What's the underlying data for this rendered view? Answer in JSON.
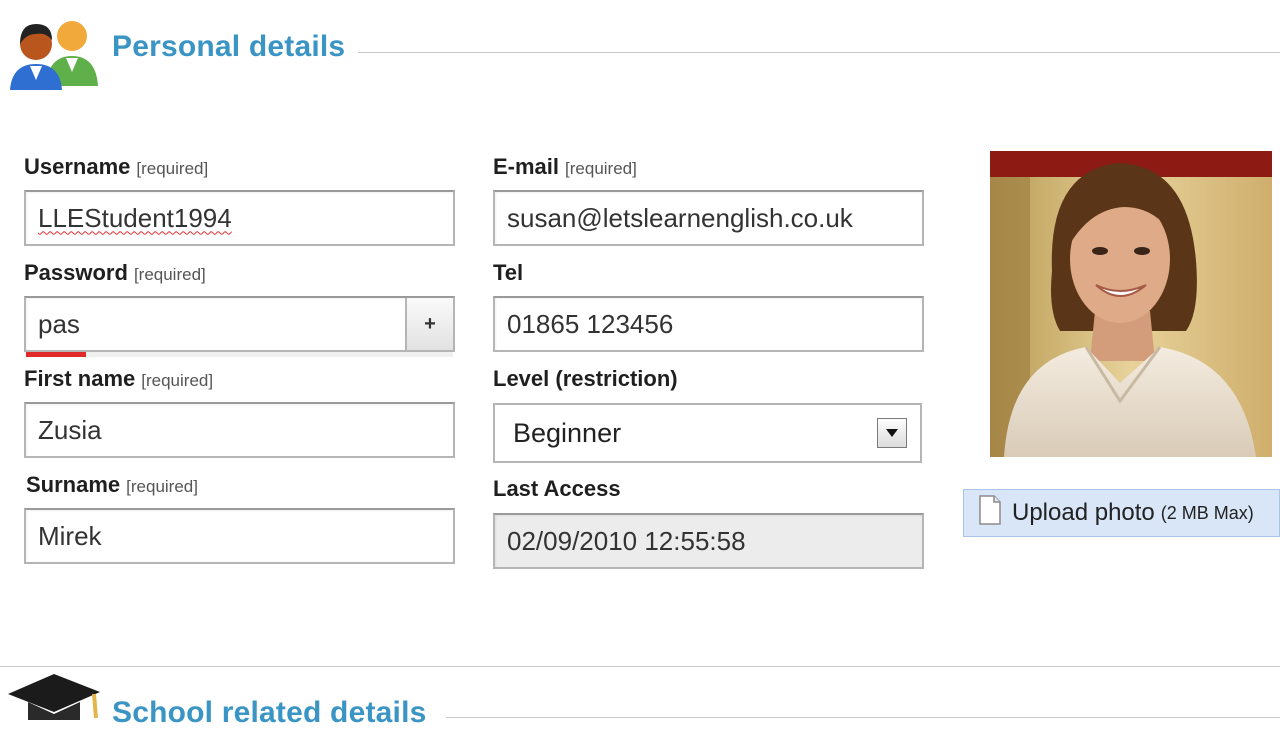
{
  "sections": {
    "personal": {
      "title": "Personal details",
      "icon": "users-icon"
    },
    "school": {
      "title": "School related details",
      "icon": "graduation-cap-icon"
    }
  },
  "required_tag": "[required]",
  "form": {
    "username": {
      "label": "Username",
      "value": "LLEStudent1994"
    },
    "email": {
      "label": "E-mail",
      "value": "susan@letslearnenglish.co.uk"
    },
    "password": {
      "label": "Password",
      "value": "pas",
      "toggle_label": "+",
      "strength_fraction": 0.14
    },
    "tel": {
      "label": "Tel",
      "value": "01865 123456"
    },
    "first_name": {
      "label": "First name",
      "value": "Zusia"
    },
    "level": {
      "label": "Level (restriction)",
      "selected": "Beginner"
    },
    "surname": {
      "label": "Surname",
      "value": "Mirek"
    },
    "last_access": {
      "label": "Last Access",
      "value": "02/09/2010 12:55:58"
    }
  },
  "photo": {
    "upload_label": "Upload photo",
    "upload_note": "(2 MB Max)",
    "upload_icon": "document-icon"
  },
  "colors": {
    "section_title": "#3a94c4",
    "strength_weak": "#e02a2a",
    "upload_bg": "#d8e6f8"
  }
}
